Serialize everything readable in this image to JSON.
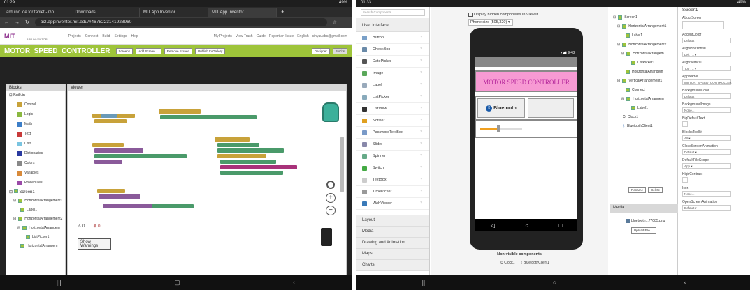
{
  "left": {
    "status": {
      "time": "01:29",
      "battery": "49%"
    },
    "tabs": [
      "arduino ide for tablet - Go",
      "Downloads",
      "MIT App Inventor",
      "MIT App Inventor"
    ],
    "url": "ai2.appinventor.mit.edu/#4678223141928960",
    "logo": "MIT",
    "logo_sub": "APP INVENTOR",
    "menu": [
      "Projects",
      "Connect",
      "Build",
      "Settings",
      "Help"
    ],
    "right_menu": [
      "My Projects",
      "View Trash",
      "Guide",
      "Report an Issue",
      "English",
      "sinyauabc@gmail.com"
    ],
    "project_name": "MOTOR_SPEED_CONTROLLER",
    "project_buttons": [
      "Screen1",
      "Add Screen ...",
      "Remove Screen",
      "Publish to Gallery"
    ],
    "mode_buttons": [
      "Designer",
      "Blocks"
    ],
    "blocks_header": "Blocks",
    "viewer_header": "Viewer",
    "builtin": "Built-in",
    "builtin_items": [
      "Control",
      "Logic",
      "Math",
      "Text",
      "Lists",
      "Dictionaries",
      "Colors",
      "Variables",
      "Procedures"
    ],
    "screen": "Screen1",
    "tree_items": [
      "HorizontalArrangement1",
      "Label1",
      "HorizontalArrangement2",
      "HorizontalArrangem",
      "ListPicker1",
      "HorizontalArrangem"
    ],
    "warn_counts": [
      "0",
      "0"
    ],
    "show_warnings": "Show Warnings"
  },
  "right": {
    "status": {
      "time": "01:33",
      "battery": "49%"
    },
    "search_placeholder": "Search Components...",
    "palette_header": "User Interface",
    "palette": [
      "Button",
      "CheckBox",
      "DatePicker",
      "Image",
      "Label",
      "ListPicker",
      "ListView",
      "Notifier",
      "PasswordTextBox",
      "Slider",
      "Spinner",
      "Switch",
      "TextBox",
      "TimePicker",
      "WebViewer"
    ],
    "categories": [
      "Layout",
      "Media",
      "Drawing and Animation",
      "Maps",
      "Charts"
    ],
    "hidden_label": "Display hidden components in Viewer",
    "phone_size": "Phone size (505,320)",
    "phone_status": "9:48",
    "app_title": "MOTOR SPEED CONTROLLER",
    "bt_button": "Bluetooth",
    "nonvisible_label": "Non-visible components",
    "nonvisible": [
      "Clock1",
      "BluetoothClient1"
    ],
    "tree": [
      "Screen1",
      "HorizontalArrangement1",
      "Label1",
      "HorizontalArrangement2",
      "HorizontalArrangem",
      "ListPicker1",
      "HorizontalArrangem",
      "VerticalArrangement1",
      "Connect",
      "HorizontalArrangem",
      "Label1",
      "Clock1",
      "BluetoothClient1"
    ],
    "tree_buttons": [
      "Rename",
      "Delete"
    ],
    "media_header": "Media",
    "media_file": "bluetooth...77085.png",
    "upload": "Upload File ...",
    "props_header": "Screen1",
    "props": [
      {
        "label": "AboutScreen",
        "value": ""
      },
      {
        "label": "AccentColor",
        "value": "Default"
      },
      {
        "label": "AlignHorizontal",
        "value": "Left : 1 ▾"
      },
      {
        "label": "AlignVertical",
        "value": "Top : 1 ▾"
      },
      {
        "label": "AppName",
        "value": "MOTOR_SPEED_CONTROLLER"
      },
      {
        "label": "BackgroundColor",
        "value": "Default"
      },
      {
        "label": "BackgroundImage",
        "value": "None..."
      },
      {
        "label": "BigDefaultText",
        "value": ""
      },
      {
        "label": "BlocksToolkit",
        "value": "All ▾"
      },
      {
        "label": "CloseScreenAnimation",
        "value": "Default ▾"
      },
      {
        "label": "DefaultFileScope",
        "value": "App ▾"
      },
      {
        "label": "HighContrast",
        "value": ""
      },
      {
        "label": "Icon",
        "value": "None..."
      },
      {
        "label": "OpenScreenAnimation",
        "value": "Default ▾"
      }
    ]
  },
  "colors": {
    "green": "#9ec43a",
    "purple": "#8b2b8b",
    "title_pink": "#f79ad3"
  }
}
